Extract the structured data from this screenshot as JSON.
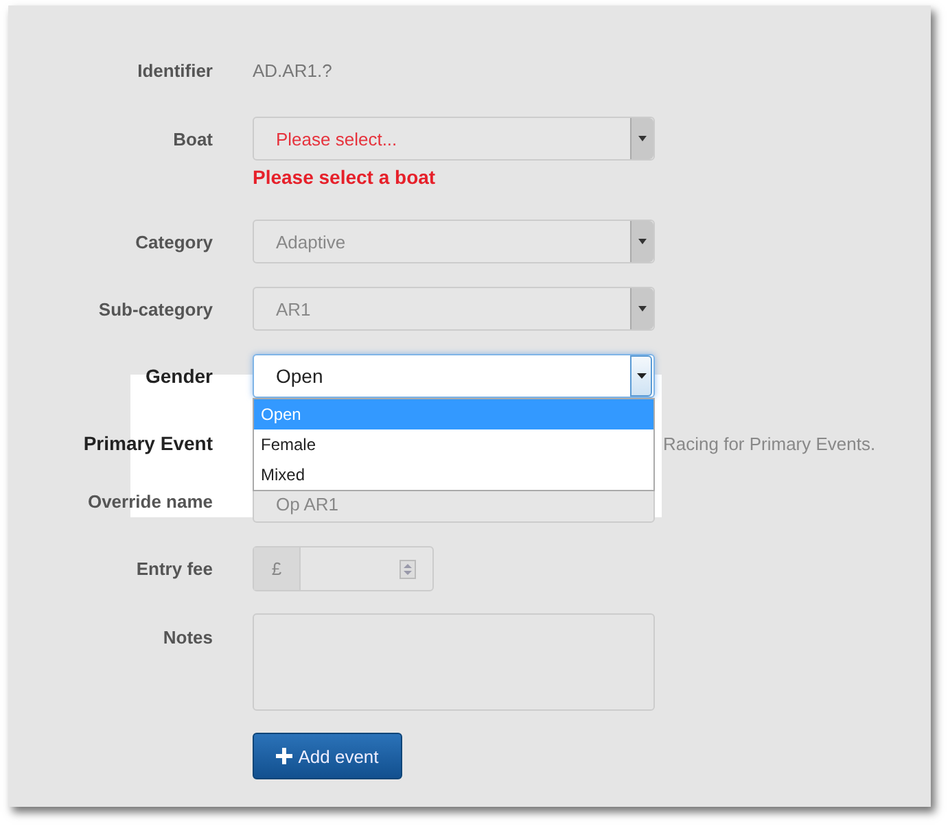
{
  "form": {
    "identifier": {
      "label": "Identifier",
      "value": "AD.AR1.?"
    },
    "boat": {
      "label": "Boat",
      "placeholder": "Please select...",
      "error": "Please select a boat"
    },
    "category": {
      "label": "Category",
      "value": "Adaptive"
    },
    "sub_category": {
      "label": "Sub-category",
      "value": "AR1"
    },
    "gender": {
      "label": "Gender",
      "value": "Open",
      "expanded": true,
      "options": [
        {
          "label": "Open",
          "selected": true
        },
        {
          "label": "Female",
          "selected": false
        },
        {
          "label": "Mixed",
          "selected": false
        }
      ]
    },
    "primary_event": {
      "label": "Primary Event",
      "help": "Racing for Primary Events."
    },
    "override_name": {
      "label": "Override name",
      "value": "Op AR1"
    },
    "entry_fee": {
      "label": "Entry fee",
      "currency": "£"
    },
    "notes": {
      "label": "Notes"
    },
    "add_button": {
      "label": "Add event"
    }
  }
}
